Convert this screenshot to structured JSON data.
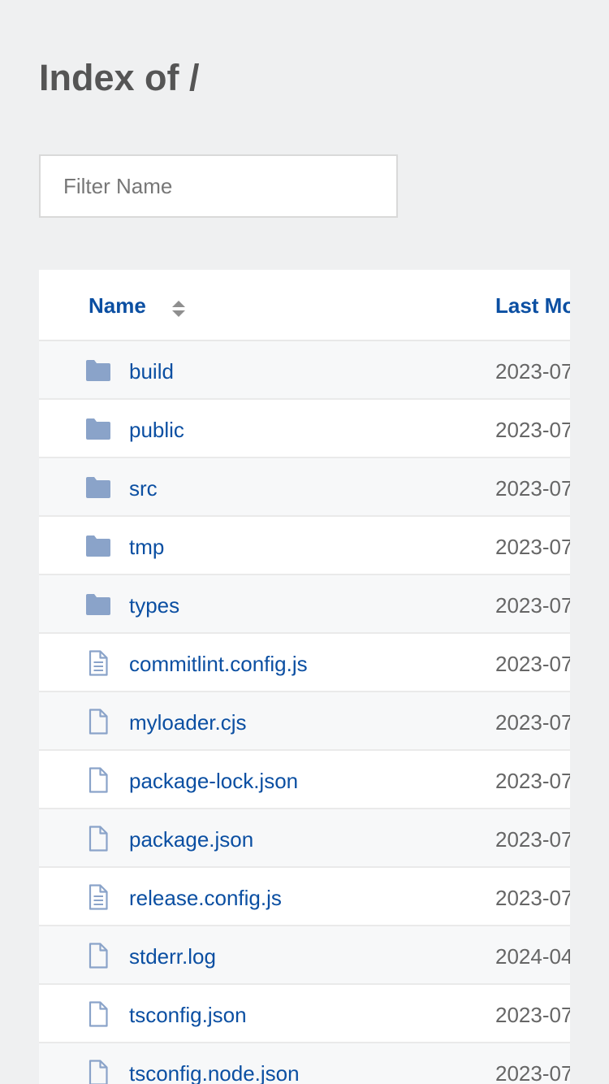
{
  "page": {
    "title": "Index of /"
  },
  "filter": {
    "placeholder": "Filter Name",
    "value": ""
  },
  "table": {
    "headers": {
      "name": "Name",
      "last_modified": "Last Mo"
    },
    "rows": [
      {
        "name": "build",
        "type": "folder",
        "icon": "folder-icon",
        "modified": "2023-07"
      },
      {
        "name": "public",
        "type": "folder",
        "icon": "folder-icon",
        "modified": "2023-07"
      },
      {
        "name": "src",
        "type": "folder",
        "icon": "folder-icon",
        "modified": "2023-07"
      },
      {
        "name": "tmp",
        "type": "folder",
        "icon": "folder-icon",
        "modified": "2023-07"
      },
      {
        "name": "types",
        "type": "folder",
        "icon": "folder-icon",
        "modified": "2023-07"
      },
      {
        "name": "commitlint.config.js",
        "type": "text-file",
        "icon": "text-file-icon",
        "modified": "2023-07"
      },
      {
        "name": "myloader.cjs",
        "type": "file",
        "icon": "file-icon",
        "modified": "2023-07"
      },
      {
        "name": "package-lock.json",
        "type": "file",
        "icon": "file-icon",
        "modified": "2023-07"
      },
      {
        "name": "package.json",
        "type": "file",
        "icon": "file-icon",
        "modified": "2023-07"
      },
      {
        "name": "release.config.js",
        "type": "text-file",
        "icon": "text-file-icon",
        "modified": "2023-07"
      },
      {
        "name": "stderr.log",
        "type": "file",
        "icon": "file-icon",
        "modified": "2024-04"
      },
      {
        "name": "tsconfig.json",
        "type": "file",
        "icon": "file-icon",
        "modified": "2023-07"
      },
      {
        "name": "tsconfig.node.json",
        "type": "file",
        "icon": "file-icon",
        "modified": "2023-07"
      }
    ]
  },
  "colors": {
    "background": "#eff0f1",
    "link": "#0b4fa2",
    "title": "#555555",
    "icon": "#8aa3c9",
    "date": "#666666"
  }
}
